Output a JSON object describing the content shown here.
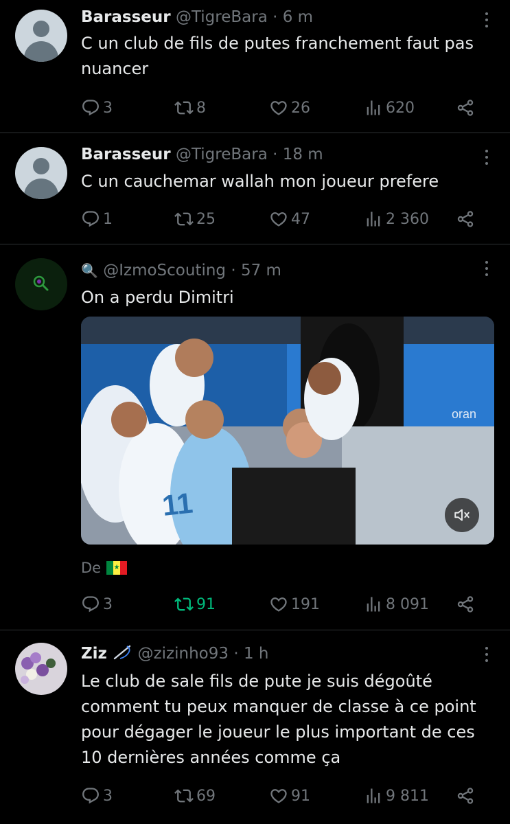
{
  "tweets": [
    {
      "name": "Barasseur",
      "handle": "@TigreBara",
      "dot": "·",
      "time": "6 m",
      "text": "C un club de fils de putes franchement faut pas nuancer",
      "replies": "3",
      "retweets": "8",
      "likes": "26",
      "views": "620"
    },
    {
      "name": "Barasseur",
      "handle": "@TigreBara",
      "dot": "·",
      "time": "18 m",
      "text": "C un cauchemar wallah mon joueur prefere",
      "replies": "1",
      "retweets": "25",
      "likes": "47",
      "views": "2 360"
    },
    {
      "name_icon": "🔍",
      "handle": "@IzmoScouting",
      "dot": "·",
      "time": "57 m",
      "text": "On a perdu Dimitri",
      "caption": "De",
      "caption_flag": "senegal-flag-icon",
      "media_sponsor": "oran",
      "replies": "3",
      "retweets": "91",
      "likes": "191",
      "views": "8 091"
    },
    {
      "name": "Ziz",
      "name_icon": "needle-icon",
      "handle": "@zizinho93",
      "dot": "·",
      "time": "1 h",
      "text": "Le club de sale fils de pute je suis dégoûté comment tu peux manquer de classe à ce point pour dégager le joueur le plus important de ces 10 dernières années comme ça",
      "replies": "3",
      "retweets": "69",
      "likes": "91",
      "views": "9 811"
    }
  ],
  "colors": {
    "background": "#000000",
    "text": "#e7e9ea",
    "muted": "#71767b",
    "retweet_active": "#00ba7c",
    "divider": "#2f3336"
  }
}
